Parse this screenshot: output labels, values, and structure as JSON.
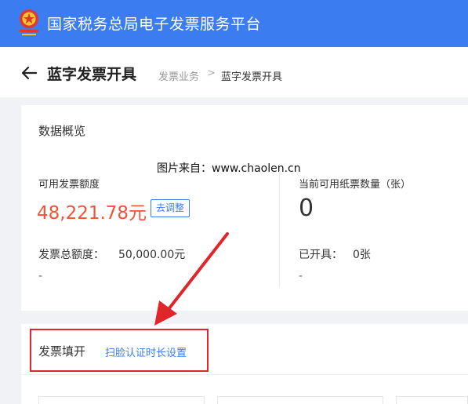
{
  "app": {
    "title": "国家税务总局电子发票服务平台",
    "brand_color": "#3b7cf0"
  },
  "header": {
    "back_icon": "arrow-left-icon",
    "title": "蓝字发票开具",
    "breadcrumb": {
      "items": [
        "发票业务",
        "蓝字发票开具"
      ],
      "separator": ">"
    }
  },
  "overview": {
    "title": "数据概览",
    "available_amount": {
      "label": "可用发票额度",
      "value": "48,221.78元",
      "adjust_button": "去调整",
      "value_color": "#f0523a"
    },
    "total_amount": {
      "label": "发票总额度：",
      "value": "50,000.00元",
      "sub": "-"
    },
    "paper_invoices": {
      "label": "当前可用纸票数量（张）",
      "value": "0"
    },
    "issued": {
      "label": "已开具：",
      "value": "0张",
      "sub": "-"
    }
  },
  "watermark": "图片来自：www.chaolen.cn",
  "invoice_fill": {
    "title": "发票填开",
    "link": "扫脸认证时长设置",
    "highlight_color": "#e0262b"
  }
}
